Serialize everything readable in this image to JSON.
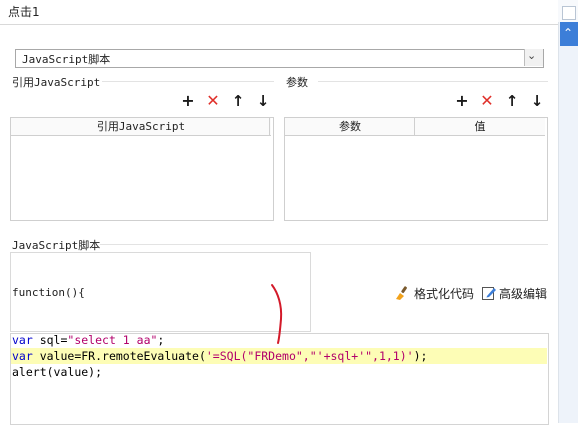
{
  "title": "点击1",
  "dropdown": {
    "value": "JavaScript脚本"
  },
  "ref_section": {
    "label": "引用JavaScript",
    "column": "引用JavaScript",
    "tools": [
      "+",
      "✕",
      "↑",
      "↓"
    ]
  },
  "params_section": {
    "label": "参数",
    "columns": [
      "参数",
      "值"
    ],
    "tools": [
      "+",
      "✕",
      "↑",
      "↓"
    ]
  },
  "script_section": {
    "label": "JavaScript脚本",
    "function_header": "function(){",
    "format_label": "格式化代码",
    "advanced_label": "高级编辑"
  },
  "code": {
    "line1": {
      "kw": "var",
      "rest": " sql=",
      "str": "\"select 1 aa\"",
      "end": ";"
    },
    "line2": {
      "kw": "var",
      "rest": " value=FR.remoteEvaluate(",
      "str": "'=SQL(\"FRDemo\",\"'+sql+'\",1,1)'",
      "end": ");"
    },
    "line3": {
      "fn": "alert",
      "arg": "(value);"
    }
  },
  "colors": {
    "accent": "#3c7ed8",
    "delete": "#e0302a",
    "highlight": "#fdfdb6",
    "keyword": "#0000cc",
    "string": "#b2006b",
    "annotation": "#d31a2a"
  }
}
